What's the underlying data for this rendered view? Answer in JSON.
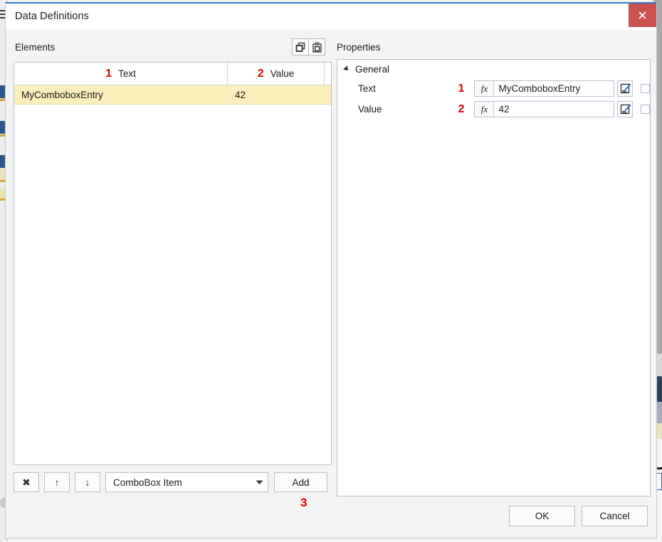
{
  "window": {
    "title": "Data Definitions",
    "close_label": "x",
    "accent_color": "#2a7fd4",
    "close_color": "#c9524f"
  },
  "annotation_color": "#e00000",
  "left_pane": {
    "label": "Elements",
    "toolbar_icons": [
      {
        "name": "copy-icon",
        "title": "Copy"
      },
      {
        "name": "paste-icon",
        "title": "Paste"
      }
    ],
    "grid": {
      "columns": [
        {
          "number": "1",
          "label": "Text"
        },
        {
          "number": "2",
          "label": "Value"
        }
      ],
      "rows": [
        {
          "text": "MyComboboxEntry",
          "value": "42",
          "selected": true
        }
      ]
    },
    "toolbar": {
      "delete_label": "✖",
      "move_up_label": "↑",
      "move_down_label": "↓",
      "type_select_value": "ComboBox Item",
      "add_label": "Add",
      "add_annotation": "3"
    }
  },
  "right_pane": {
    "label": "Properties",
    "group": {
      "label": "General",
      "expanded": true
    },
    "properties": [
      {
        "number": "1",
        "name": "Text",
        "fx_label": "fx",
        "value": "MyComboboxEntry",
        "placeholder": "",
        "edit_icon": "expression-editor-icon",
        "checkbox_checked": false
      },
      {
        "number": "2",
        "name": "Value",
        "fx_label": "fx",
        "value": "42",
        "placeholder": "",
        "edit_icon": "expression-editor-icon",
        "checkbox_checked": false
      }
    ]
  },
  "footer": {
    "ok_label": "OK",
    "cancel_label": "Cancel"
  }
}
